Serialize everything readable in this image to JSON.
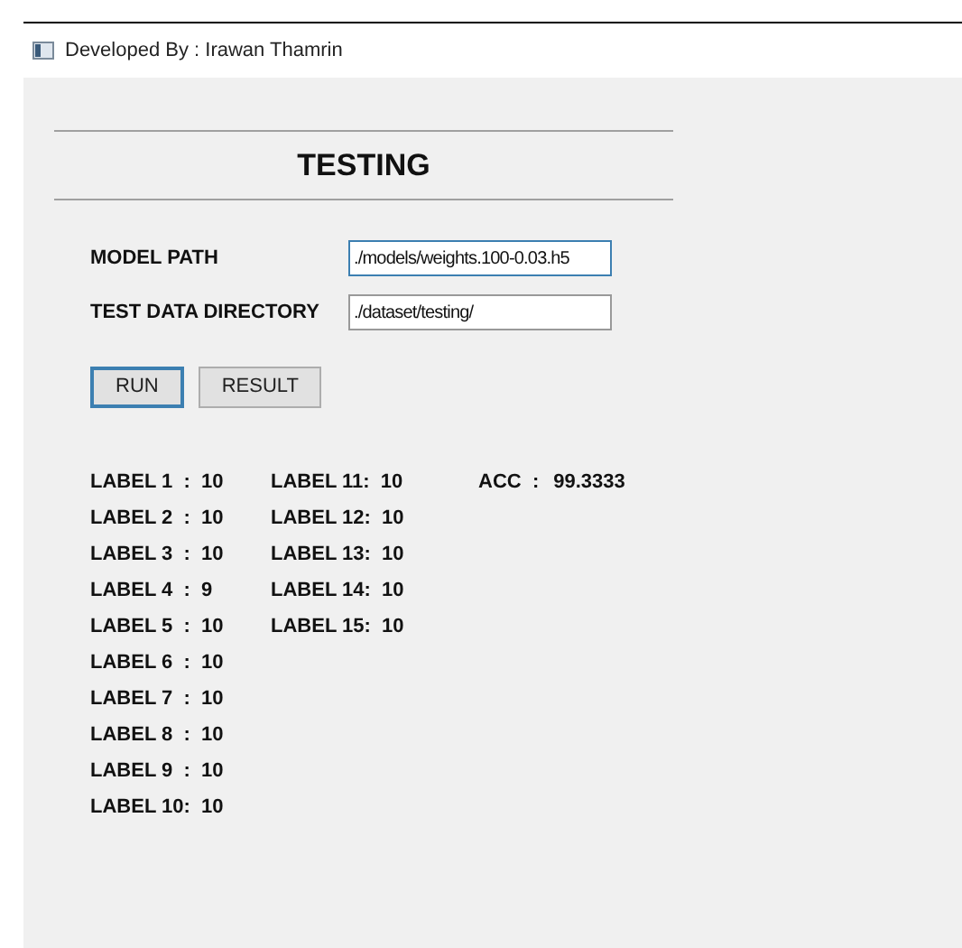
{
  "window": {
    "title": "Developed By : Irawan Thamrin"
  },
  "heading": "TESTING",
  "fields": [
    {
      "label": "MODEL PATH",
      "value": "./models/weights.100-0.03.h5",
      "focused": true
    },
    {
      "label": "TEST DATA DIRECTORY",
      "value": "./dataset/testing/",
      "focused": false
    }
  ],
  "buttons": [
    {
      "label": "RUN",
      "focused": true
    },
    {
      "label": "RESULT",
      "focused": false
    }
  ],
  "results": {
    "columns": [
      [
        "LABEL 1  :  10",
        "LABEL 2  :  10",
        "LABEL 3  :  10",
        "LABEL 4  :  9",
        "LABEL 5  :  10",
        "LABEL 6  :  10",
        "LABEL 7  :  10",
        "LABEL 8  :  10",
        "LABEL 9  :  10",
        "LABEL 10:  10"
      ],
      [
        "LABEL 11:  10",
        "LABEL 12:  10",
        "LABEL 13:  10",
        "LABEL 14:  10",
        "LABEL 15:  10"
      ]
    ],
    "accuracy": {
      "label": "ACC  :",
      "value": "99.3333"
    }
  }
}
